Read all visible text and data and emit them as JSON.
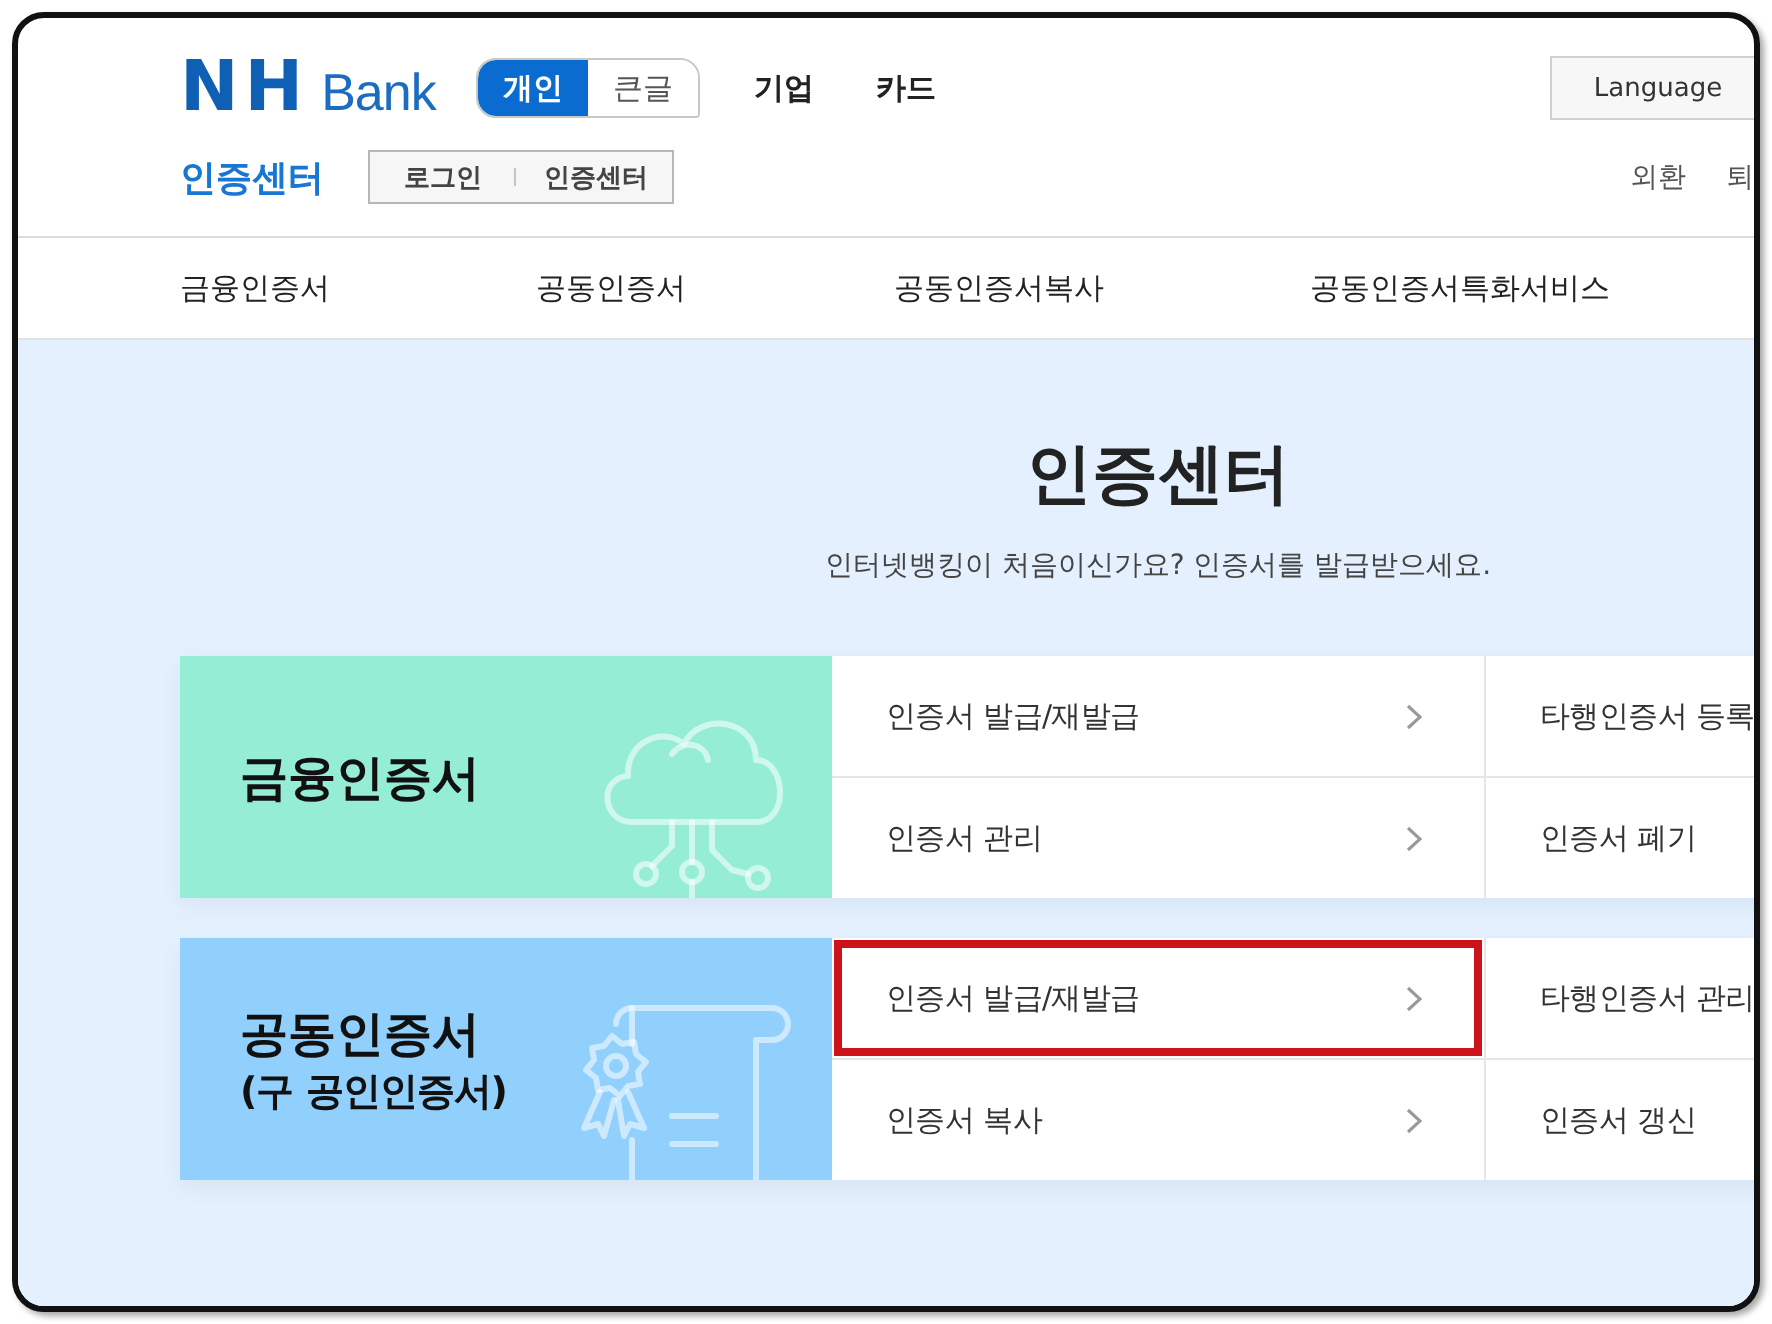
{
  "header": {
    "logo": {
      "mark": "NH",
      "name": "Bank"
    },
    "view_toggle": [
      {
        "label": "개인",
        "selected": true
      },
      {
        "label": "큰글",
        "selected": false
      }
    ],
    "menu": [
      "기업",
      "카드"
    ],
    "language_button": "Language",
    "section_title": "인증센터",
    "breadcrumb": [
      "로그인",
      "인증센터"
    ],
    "utility_links": [
      "외환",
      "퇴"
    ]
  },
  "nav": [
    "금융인증서",
    "공동인증서",
    "공동인증서복사",
    "공동인증서특화서비스"
  ],
  "hero": {
    "title": "인증센터",
    "subtitle": "인터넷뱅킹이 처음이신가요? 인증서를 발급받으세요."
  },
  "cards": [
    {
      "kind": "cloud",
      "title": "금융인증서",
      "color": "#96edd5",
      "columns": [
        {
          "items": [
            {
              "label": "인증서 발급/재발급",
              "arrow": true,
              "highlighted": false
            },
            {
              "label": "인증서 관리",
              "arrow": true,
              "highlighted": false
            }
          ]
        },
        {
          "items": [
            {
              "label": "타행인증서 등록",
              "highlighted": false
            },
            {
              "label": "인증서 폐기",
              "highlighted": false
            }
          ]
        }
      ]
    },
    {
      "kind": "certificate",
      "title": "공동인증서",
      "subtitle": "(구 공인인증서)",
      "color": "#91cffc",
      "columns": [
        {
          "items": [
            {
              "label": "인증서 발급/재발급",
              "arrow": true,
              "highlighted": true
            },
            {
              "label": "인증서 복사",
              "arrow": true,
              "highlighted": false
            }
          ]
        },
        {
          "items": [
            {
              "label": "타행인증서 관리",
              "highlighted": false
            },
            {
              "label": "인증서 갱신",
              "highlighted": false
            }
          ]
        }
      ]
    }
  ]
}
